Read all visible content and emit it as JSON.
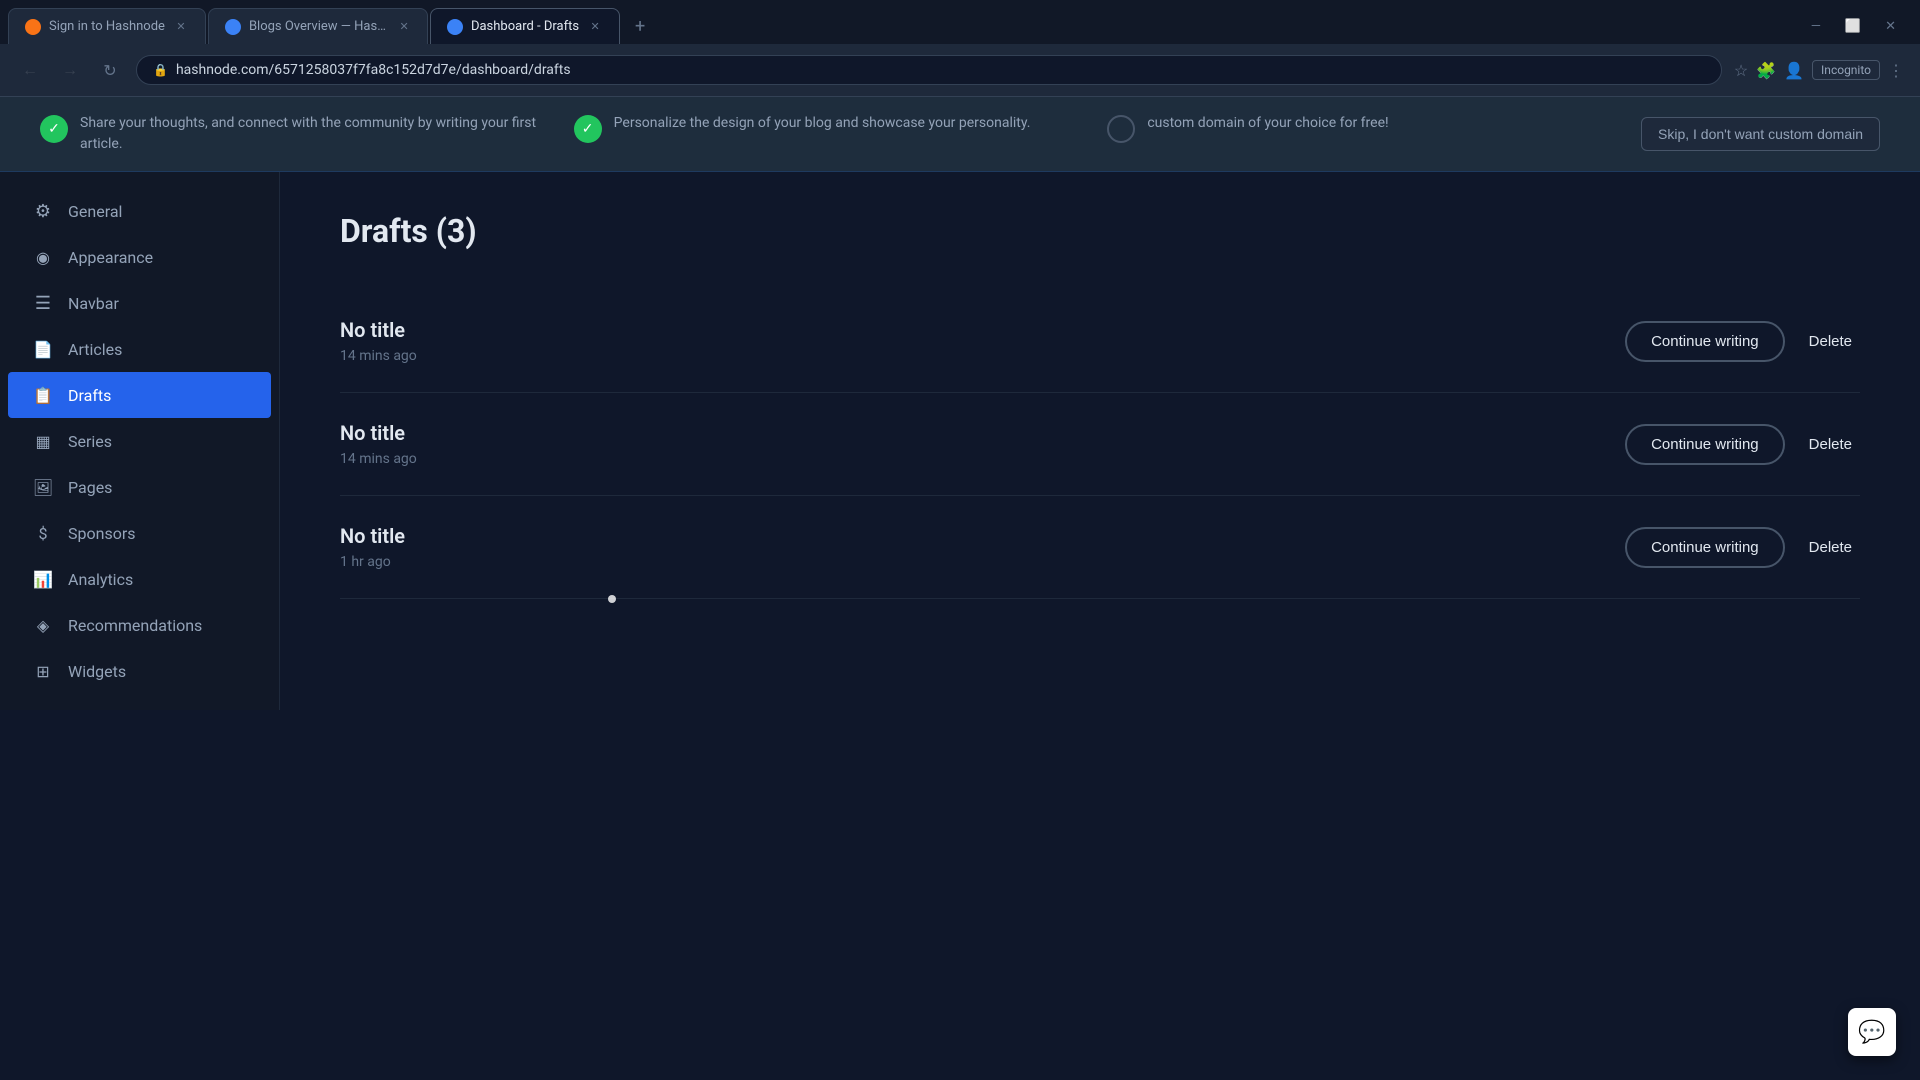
{
  "browser": {
    "tabs": [
      {
        "id": "tab1",
        "favicon_color": "#f97316",
        "label": "Sign in to Hashnode",
        "active": false
      },
      {
        "id": "tab2",
        "favicon_color": "#3b82f6",
        "label": "Blogs Overview — Hashnode",
        "active": false
      },
      {
        "id": "tab3",
        "favicon_color": "#3b82f6",
        "label": "Dashboard - Drafts",
        "active": true
      }
    ],
    "url": "hashnode.com/6571258037f7fa8c152d7d7e/dashboard/drafts",
    "profile_label": "Incognito"
  },
  "banner": {
    "items": [
      {
        "type": "check",
        "text": "Share your thoughts, and connect with the community by writing your first article."
      },
      {
        "type": "check",
        "text": "Personalize the design of your blog and showcase your personality."
      },
      {
        "type": "circle",
        "text": "custom domain of your choice for free!"
      }
    ],
    "skip_label": "Skip, I don't want custom domain"
  },
  "sidebar": {
    "items": [
      {
        "id": "general",
        "label": "General",
        "icon": "⚙"
      },
      {
        "id": "appearance",
        "label": "Appearance",
        "icon": "◎"
      },
      {
        "id": "navbar",
        "label": "Navbar",
        "icon": "☰"
      },
      {
        "id": "articles",
        "label": "Articles",
        "icon": "📄"
      },
      {
        "id": "drafts",
        "label": "Drafts",
        "icon": "📋",
        "active": true
      },
      {
        "id": "series",
        "label": "Series",
        "icon": "▦"
      },
      {
        "id": "pages",
        "label": "Pages",
        "icon": "🖼"
      },
      {
        "id": "sponsors",
        "label": "Sponsors",
        "icon": "$"
      },
      {
        "id": "analytics",
        "label": "Analytics",
        "icon": "📊"
      },
      {
        "id": "recommendations",
        "label": "Recommendations",
        "icon": "◈"
      },
      {
        "id": "widgets",
        "label": "Widgets",
        "icon": "⊞"
      }
    ]
  },
  "page": {
    "title": "Drafts (3)",
    "drafts": [
      {
        "id": "draft1",
        "title": "No title",
        "time": "14 mins ago",
        "continue_label": "Continue writing",
        "delete_label": "Delete"
      },
      {
        "id": "draft2",
        "title": "No title",
        "time": "14 mins ago",
        "continue_label": "Continue writing",
        "delete_label": "Delete"
      },
      {
        "id": "draft3",
        "title": "No title",
        "time": "1 hr ago",
        "continue_label": "Continue writing",
        "delete_label": "Delete"
      }
    ]
  }
}
